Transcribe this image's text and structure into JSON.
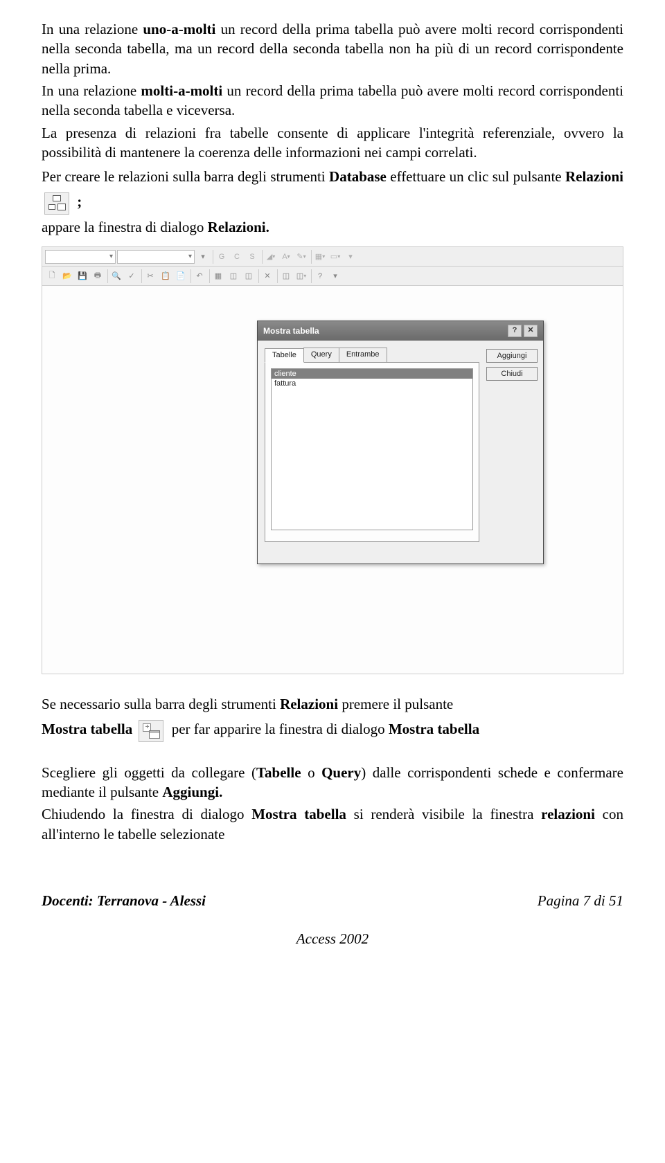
{
  "paragraphs": {
    "p1_a": "In una relazione ",
    "p1_b": "uno-a-molti",
    "p1_c": " un record della prima tabella può avere molti record corrispondenti nella seconda tabella, ma un record della seconda tabella non ha più di un record corrispondente nella prima.",
    "p2_a": "In una relazione ",
    "p2_b": "molti-a-molti",
    "p2_c": " un record della prima tabella può avere molti record corrispondenti nella seconda tabella e viceversa.",
    "p3": "La presenza di relazioni fra tabelle consente di applicare l'integrità referenziale, ovvero la possibilità di mantenere la coerenza delle informazioni nei campi correlati.",
    "p4_a": "Per creare le relazioni sulla barra degli strumenti ",
    "p4_b": "Database",
    "p4_c": " effettuare un clic sul pulsante ",
    "p4_d": "Relazioni",
    "p4_e": " ;",
    "p5_a": "appare la finestra di dialogo ",
    "p5_b": "Relazioni.",
    "p6_a": "Se necessario sulla barra degli strumenti ",
    "p6_b": "Relazioni",
    "p6_c": " premere il pulsante ",
    "p6_d": "Mostra tabella",
    "p6_e": " per far apparire la finestra di dialogo ",
    "p6_f": "Mostra tabella",
    "p7_a": "Scegliere gli oggetti da collegare (",
    "p7_b": "Tabelle",
    "p7_c": " o ",
    "p7_d": "Query",
    "p7_e": ") dalle corrispondenti schede e confermare mediante il pulsante ",
    "p7_f": "Aggiungi.",
    "p8_a": "Chiudendo la finestra di dialogo ",
    "p8_b": "Mostra tabella",
    "p8_c": " si renderà visibile la finestra ",
    "p8_d": "relazioni",
    "p8_e": " con all'interno le tabelle selezionate"
  },
  "toolbar": {
    "row1": [
      "G",
      "C",
      "S",
      "✎",
      "A",
      "⌄",
      "▭"
    ],
    "row2": [
      "🗋",
      "📂",
      "💾",
      "🖶",
      "🔍",
      "✔",
      "✂",
      "📋",
      "📄",
      "⎌",
      "⤺",
      "◫",
      "◫",
      "✕",
      "◫",
      "◫",
      "?"
    ]
  },
  "dialog": {
    "title": "Mostra tabella",
    "help": "?",
    "close": "✕",
    "tabs": [
      "Tabelle",
      "Query",
      "Entrambe"
    ],
    "active_tab": 0,
    "list": [
      "cliente",
      "fattura"
    ],
    "selected_index": 0,
    "buttons": {
      "add": "Aggiungi",
      "close_btn": "Chiudi"
    }
  },
  "footer": {
    "left": "Docenti: Terranova - Alessi",
    "right": "Pagina 7 di 51",
    "center": "Access 2002"
  }
}
